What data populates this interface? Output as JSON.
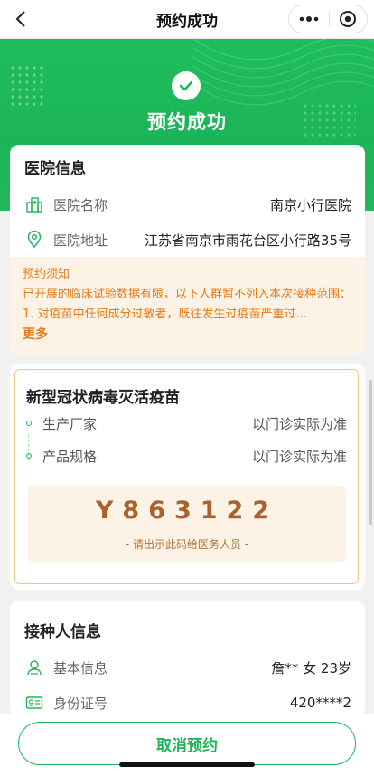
{
  "nav": {
    "title": "预约成功"
  },
  "hero": {
    "title": "预约成功"
  },
  "hospital": {
    "section_title": "医院信息",
    "name_label": "医院名称",
    "name_value": "南京小行医院",
    "address_label": "医院地址",
    "address_value": "江苏省南京市雨花台区小行路35号"
  },
  "notice": {
    "title": "预约须知",
    "text": "已开展的临床试验数据有限，以下人群暂不列入本次接种范围：1. 对疫苗中任何成分过敏者，既往发生过疫苗严重过...",
    "more": "更多"
  },
  "vaccine": {
    "title": "新型冠状病毒灭活疫苗",
    "rows": [
      {
        "label": "生产厂家",
        "value": "以门诊实际为准"
      },
      {
        "label": "产品规格",
        "value": "以门诊实际为准"
      }
    ],
    "code": "Y863122",
    "code_hint": "- 请出示此码给医务人员 -"
  },
  "recipient": {
    "section_title": "接种人信息",
    "basic_label": "基本信息",
    "basic_value": "詹** 女 23岁",
    "id_label": "身份证号",
    "id_value": "420****2"
  },
  "footer": {
    "cancel_label": "取消预约"
  },
  "colors": {
    "primary_green": "#1fb65a",
    "notice_orange": "#e67a17",
    "code_brown": "#a9612d"
  }
}
